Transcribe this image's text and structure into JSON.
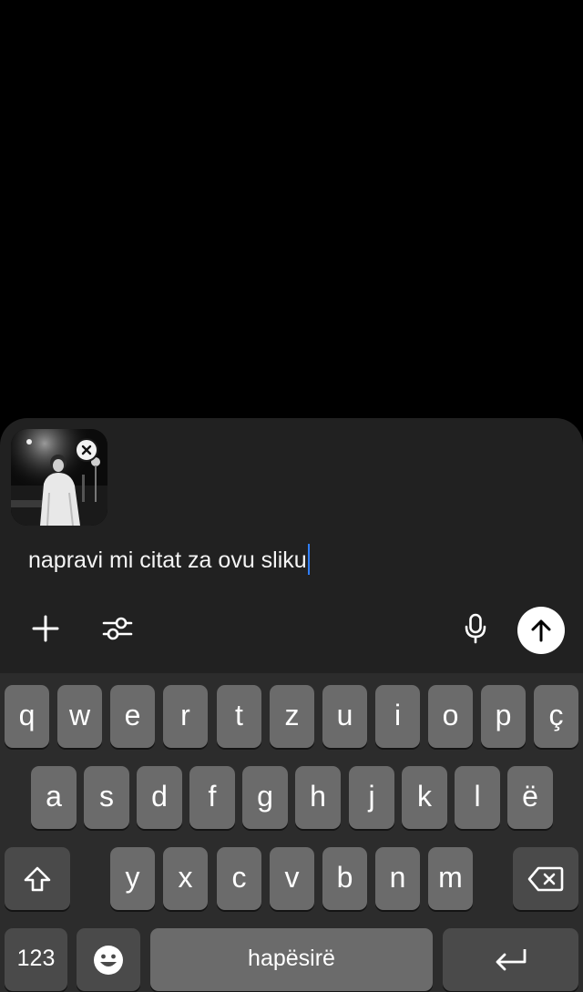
{
  "composer": {
    "prompt_text": "napravi mi citat za ovu sliku",
    "attachment": {
      "kind": "photo",
      "remove_icon": "close-icon"
    },
    "tools": {
      "add_icon": "plus-icon",
      "tune_icon": "sliders-icon",
      "mic_icon": "microphone-icon",
      "send_icon": "arrow-up-icon"
    },
    "colors": {
      "panel": "#212121",
      "caret": "#2f7fff",
      "send_bg": "#ffffff"
    }
  },
  "keyboard": {
    "row1": [
      "q",
      "w",
      "e",
      "r",
      "t",
      "z",
      "u",
      "i",
      "o",
      "p",
      "ç"
    ],
    "row2": [
      "a",
      "s",
      "d",
      "f",
      "g",
      "h",
      "j",
      "k",
      "l",
      "ë"
    ],
    "row3": [
      "y",
      "x",
      "c",
      "v",
      "b",
      "n",
      "m"
    ],
    "numbers_label": "123",
    "space_label": "hapësirë",
    "shift_icon": "shift-icon",
    "delete_icon": "backspace-icon",
    "emoji_icon": "emoji-icon",
    "return_icon": "return-icon",
    "colors": {
      "key": "#6b6b6b",
      "func_key": "#4a4a4a",
      "background": "#2c2c2c"
    }
  }
}
